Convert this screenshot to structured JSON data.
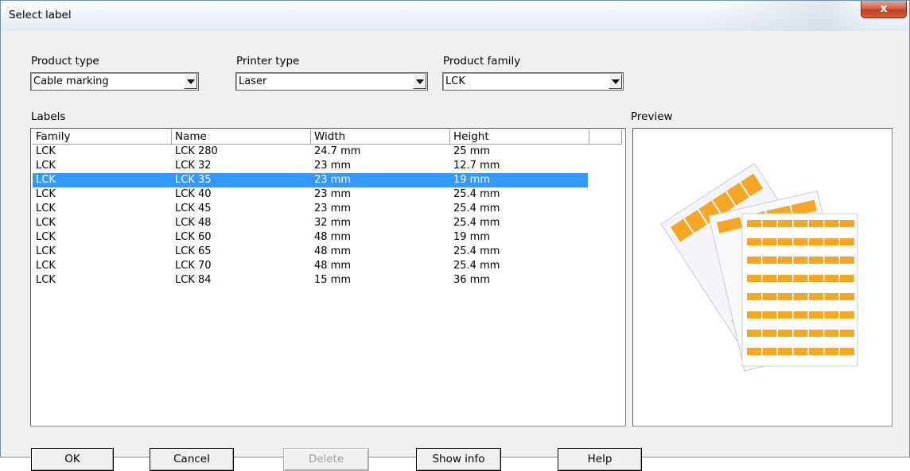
{
  "window": {
    "title": "Select label",
    "close_label": "x"
  },
  "filters": {
    "product_type": {
      "label": "Product type",
      "value": "Cable marking"
    },
    "printer_type": {
      "label": "Printer type",
      "value": "Laser"
    },
    "product_family": {
      "label": "Product family",
      "value": "LCK"
    }
  },
  "labels": {
    "title": "Labels",
    "columns": [
      "Family",
      "Name",
      "Width",
      "Height"
    ],
    "selected_index": 2,
    "rows": [
      [
        "LCK",
        "LCK 280",
        "24.7 mm",
        "25 mm"
      ],
      [
        "LCK",
        "LCK 32",
        "23 mm",
        "12.7 mm"
      ],
      [
        "LCK",
        "LCK 35",
        "23 mm",
        "19 mm"
      ],
      [
        "LCK",
        "LCK 40",
        "23 mm",
        "25.4 mm"
      ],
      [
        "LCK",
        "LCK 45",
        "23 mm",
        "25.4 mm"
      ],
      [
        "LCK",
        "LCK 48",
        "32 mm",
        "25.4 mm"
      ],
      [
        "LCK",
        "LCK 60",
        "48 mm",
        "19 mm"
      ],
      [
        "LCK",
        "LCK 65",
        "48 mm",
        "25.4 mm"
      ],
      [
        "LCK",
        "LCK 70",
        "48 mm",
        "25.4 mm"
      ],
      [
        "LCK",
        "LCK 84",
        "15 mm",
        "36 mm"
      ]
    ]
  },
  "preview": {
    "title": "Preview",
    "label_color": "#f5a623"
  },
  "buttons": {
    "ok": "OK",
    "cancel": "Cancel",
    "delete": "Delete",
    "show_info": "Show info",
    "help": "Help"
  }
}
